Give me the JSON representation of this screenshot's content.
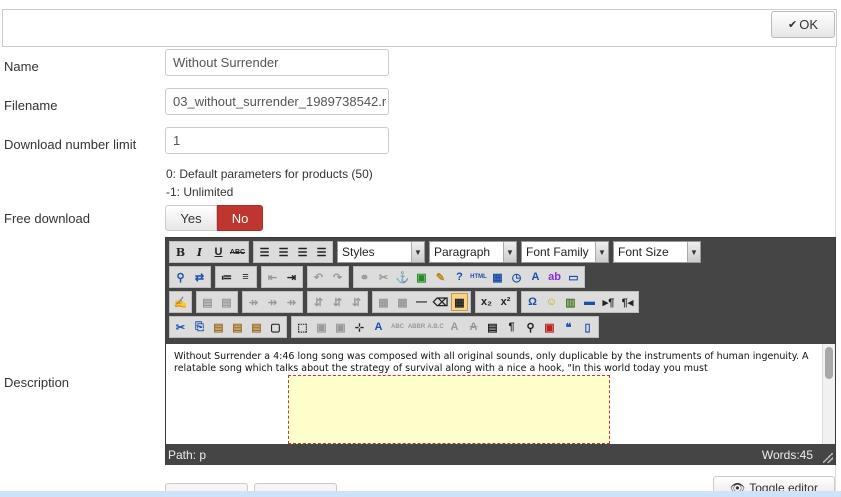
{
  "toolbar": {
    "ok_label": "OK"
  },
  "form": {
    "name": {
      "label": "Name",
      "value": "Without Surrender"
    },
    "filename": {
      "label": "Filename",
      "value": "03_without_surrender_1989738542.r"
    },
    "download_limit": {
      "label": "Download number limit",
      "value": "1",
      "help_line1": "0: Default parameters for products (50)",
      "help_line2": "-1: Unlimited"
    },
    "free_download": {
      "label": "Free download",
      "yes": "Yes",
      "no": "No",
      "selected": "No"
    },
    "description": {
      "label": "Description"
    }
  },
  "editor": {
    "dropdowns": {
      "styles": "Styles",
      "format": "Paragraph",
      "font_family": "Font Family",
      "font_size": "Font Size"
    },
    "content_text": "Without Surrender a 4:46 long song was composed with all original sounds, only duplicable by the instruments of human ingenuity. A relatable song which talks about the strategy of survival along with a nice a hook, \"In this world today you must",
    "path": "Path: p",
    "words": "Words:45"
  },
  "bottom": {
    "toggle_editor_label": "Toggle editor"
  },
  "colors": {
    "accent_no": "#bd362f",
    "editor_bg": "#454545",
    "placeholder_bg": "#ffffcc"
  }
}
